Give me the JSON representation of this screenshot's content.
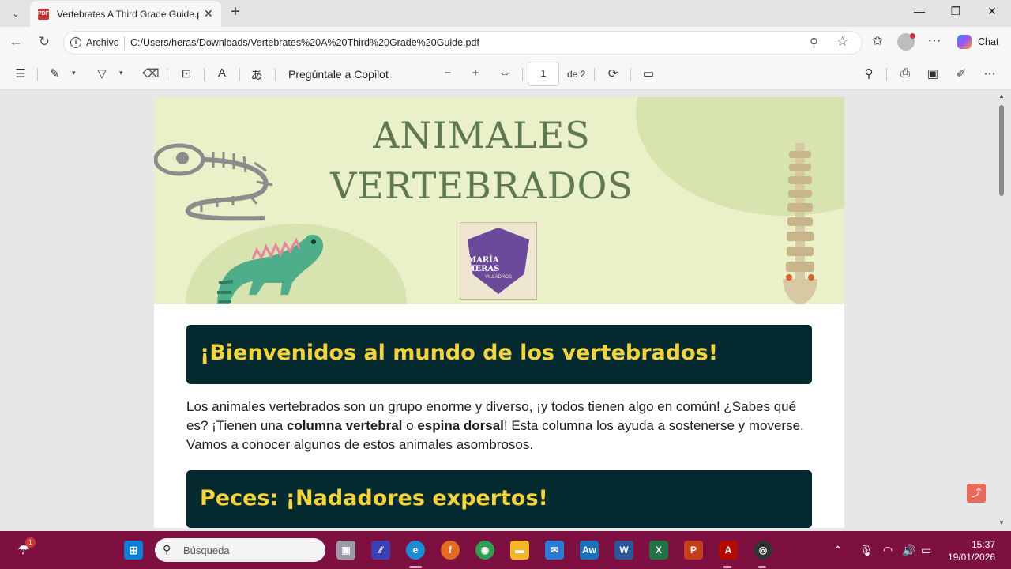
{
  "browser": {
    "tab_title": "Vertebrates A Third Grade Guide.pdf",
    "address_scheme": "Archivo",
    "url": "C:/Users/heras/Downloads/Vertebrates%20A%20Third%20Grade%20Guide.pdf",
    "chat_label": "Chat"
  },
  "pdf_toolbar": {
    "copilot_label": "Pregúntale a Copilot",
    "page_number": "1",
    "page_count": "de 2"
  },
  "document": {
    "banner_title_line1": "ANIMALES",
    "banner_title_line2": "VERTEBRADOS",
    "logo_name": "MARÍA HERAS",
    "logo_subtitle": "VILLADROS",
    "welcome_heading": "¡Bienvenidos al mundo de los vertebrados!",
    "intro_part1": "Los animales vertebrados son un grupo enorme y diverso, ¡y todos tienen algo en común! ¿Sabes qué es? ¡Tienen una ",
    "intro_bold1": "columna vertebral",
    "intro_part2": " o ",
    "intro_bold2": "espina dorsal",
    "intro_part3": "! Esta columna los ayuda a sostenerse y moverse. Vamos a conocer algunos de estos animales asombrosos.",
    "fish_heading": "Peces: ¡Nadadores expertos!"
  },
  "taskbar": {
    "search_placeholder": "Búsqueda",
    "weather_badge": "1",
    "time": "15:37",
    "date": "19/01/2026"
  },
  "colors": {
    "banner_bg": "#eaf0c8",
    "heading_bg": "#04292f",
    "heading_text": "#f5d33c",
    "banner_title": "#5f7a52",
    "taskbar": "#7d1040"
  }
}
